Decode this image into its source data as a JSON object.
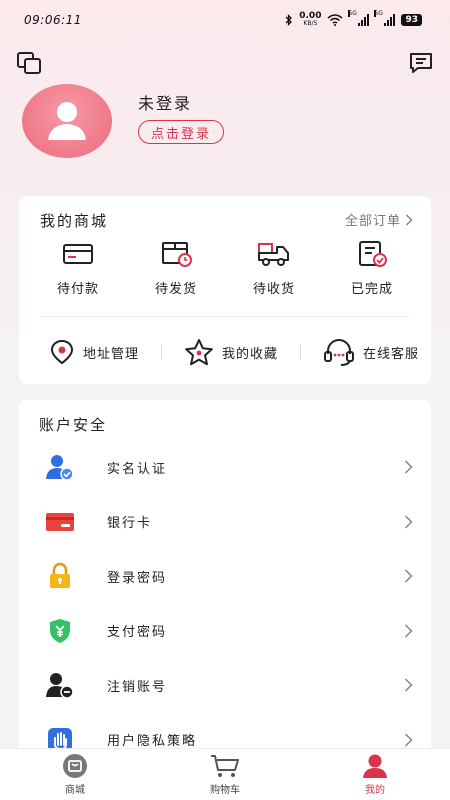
{
  "status_bar": {
    "time": "09:06:11",
    "net_speed": "0.00",
    "net_unit": "KB/S",
    "signal_1": "5G",
    "signal_2": "5G",
    "battery": "93"
  },
  "profile": {
    "status_text": "未登录",
    "login_button": "点击登录"
  },
  "my_mall": {
    "title": "我的商城",
    "all_orders": "全部订单",
    "orders": [
      {
        "label": "待付款",
        "icon": "wallet-card-icon"
      },
      {
        "label": "待发货",
        "icon": "box-clock-icon"
      },
      {
        "label": "待收货",
        "icon": "truck-icon"
      },
      {
        "label": "已完成",
        "icon": "order-check-icon"
      }
    ],
    "services": [
      {
        "label": "地址管理",
        "icon": "location-pin-icon"
      },
      {
        "label": "我的收藏",
        "icon": "star-icon"
      },
      {
        "label": "在线客服",
        "icon": "headset-icon"
      }
    ]
  },
  "account_security": {
    "title": "账户安全",
    "items": [
      {
        "label": "实名认证",
        "icon": "user-verified-icon"
      },
      {
        "label": "银行卡",
        "icon": "bank-card-icon"
      },
      {
        "label": "登录密码",
        "icon": "lock-icon"
      },
      {
        "label": "支付密码",
        "icon": "shield-yuan-icon"
      },
      {
        "label": "注销账号",
        "icon": "user-remove-icon"
      },
      {
        "label": "用户隐私策略",
        "icon": "hand-privacy-icon"
      }
    ]
  },
  "tab_bar": {
    "tabs": [
      {
        "label": "商城",
        "active": false
      },
      {
        "label": "购物车",
        "active": false
      },
      {
        "label": "我的",
        "active": true
      }
    ]
  },
  "colors": {
    "accent": "#d9344a",
    "avatar": "#ec6b7b",
    "blue": "#2f6fe0",
    "yellow": "#f5b51b",
    "green": "#35c06a"
  }
}
